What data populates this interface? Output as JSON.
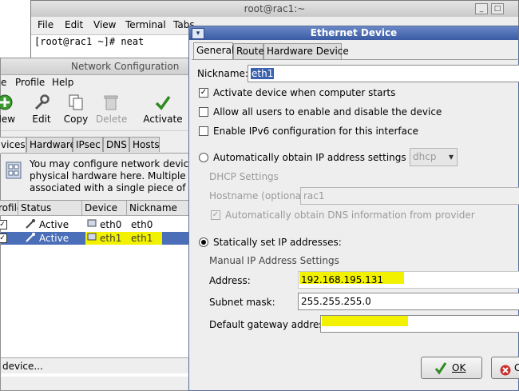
{
  "terminal": {
    "title": "root@rac1:~",
    "menu": [
      "File",
      "Edit",
      "View",
      "Terminal",
      "Tabs"
    ],
    "prompt_line": "[root@rac1 ~]# neat"
  },
  "netconf": {
    "title": "Network Configuration",
    "menu": [
      "e",
      "Profile",
      "Help"
    ],
    "toolbar": {
      "new_label": "New",
      "edit_label": "Edit",
      "copy_label": "Copy",
      "delete_label": "Delete",
      "activate_label": "Activate"
    },
    "tabs": [
      "vices",
      "Hardware",
      "IPsec",
      "DNS",
      "Hosts"
    ],
    "info_lines": [
      "You may configure network devices a",
      "physical hardware here.  Multiple logic",
      "associated with a single piece of hardw"
    ],
    "columns": [
      "rofile",
      "Status",
      "Device",
      "Nickname"
    ],
    "rows": [
      {
        "status": "Active",
        "device": "eth0",
        "nickname": "eth0",
        "selected": false
      },
      {
        "status": "Active",
        "device": "eth1",
        "nickname": "eth1",
        "selected": true
      }
    ],
    "status_bar": "device..."
  },
  "dialog": {
    "title": "Ethernet Device",
    "tabs": [
      "General",
      "Route",
      "Hardware Device"
    ],
    "nickname_label": "Nickname:",
    "nickname_value": "eth1",
    "activate_on_start_label": "Activate device when computer starts",
    "allow_users_label": "Allow all users to enable and disable the device",
    "ipv6_label": "Enable IPv6 configuration for this interface",
    "auto_ip_label": "Automatically obtain IP address settings with:",
    "auto_ip_method": "dhcp",
    "dhcp_settings_label": "DHCP Settings",
    "hostname_label": "Hostname (optional):",
    "hostname_value": "rac1",
    "auto_dns_label": "Automatically obtain DNS information from provider",
    "static_label": "Statically set IP addresses:",
    "manual_label": "Manual IP Address Settings",
    "address_label": "Address:",
    "address_value": "192.168.195.131",
    "subnet_label": "Subnet mask:",
    "subnet_value": "255.255.255.0",
    "gateway_label": "Default gateway address:",
    "gateway_value": "",
    "ok_label": "OK",
    "cancel_partial_label": "C"
  },
  "colors": {
    "highlight": "#f2f200",
    "selection": "#4a6eb8",
    "dialog_title": "#3a5ba4"
  }
}
